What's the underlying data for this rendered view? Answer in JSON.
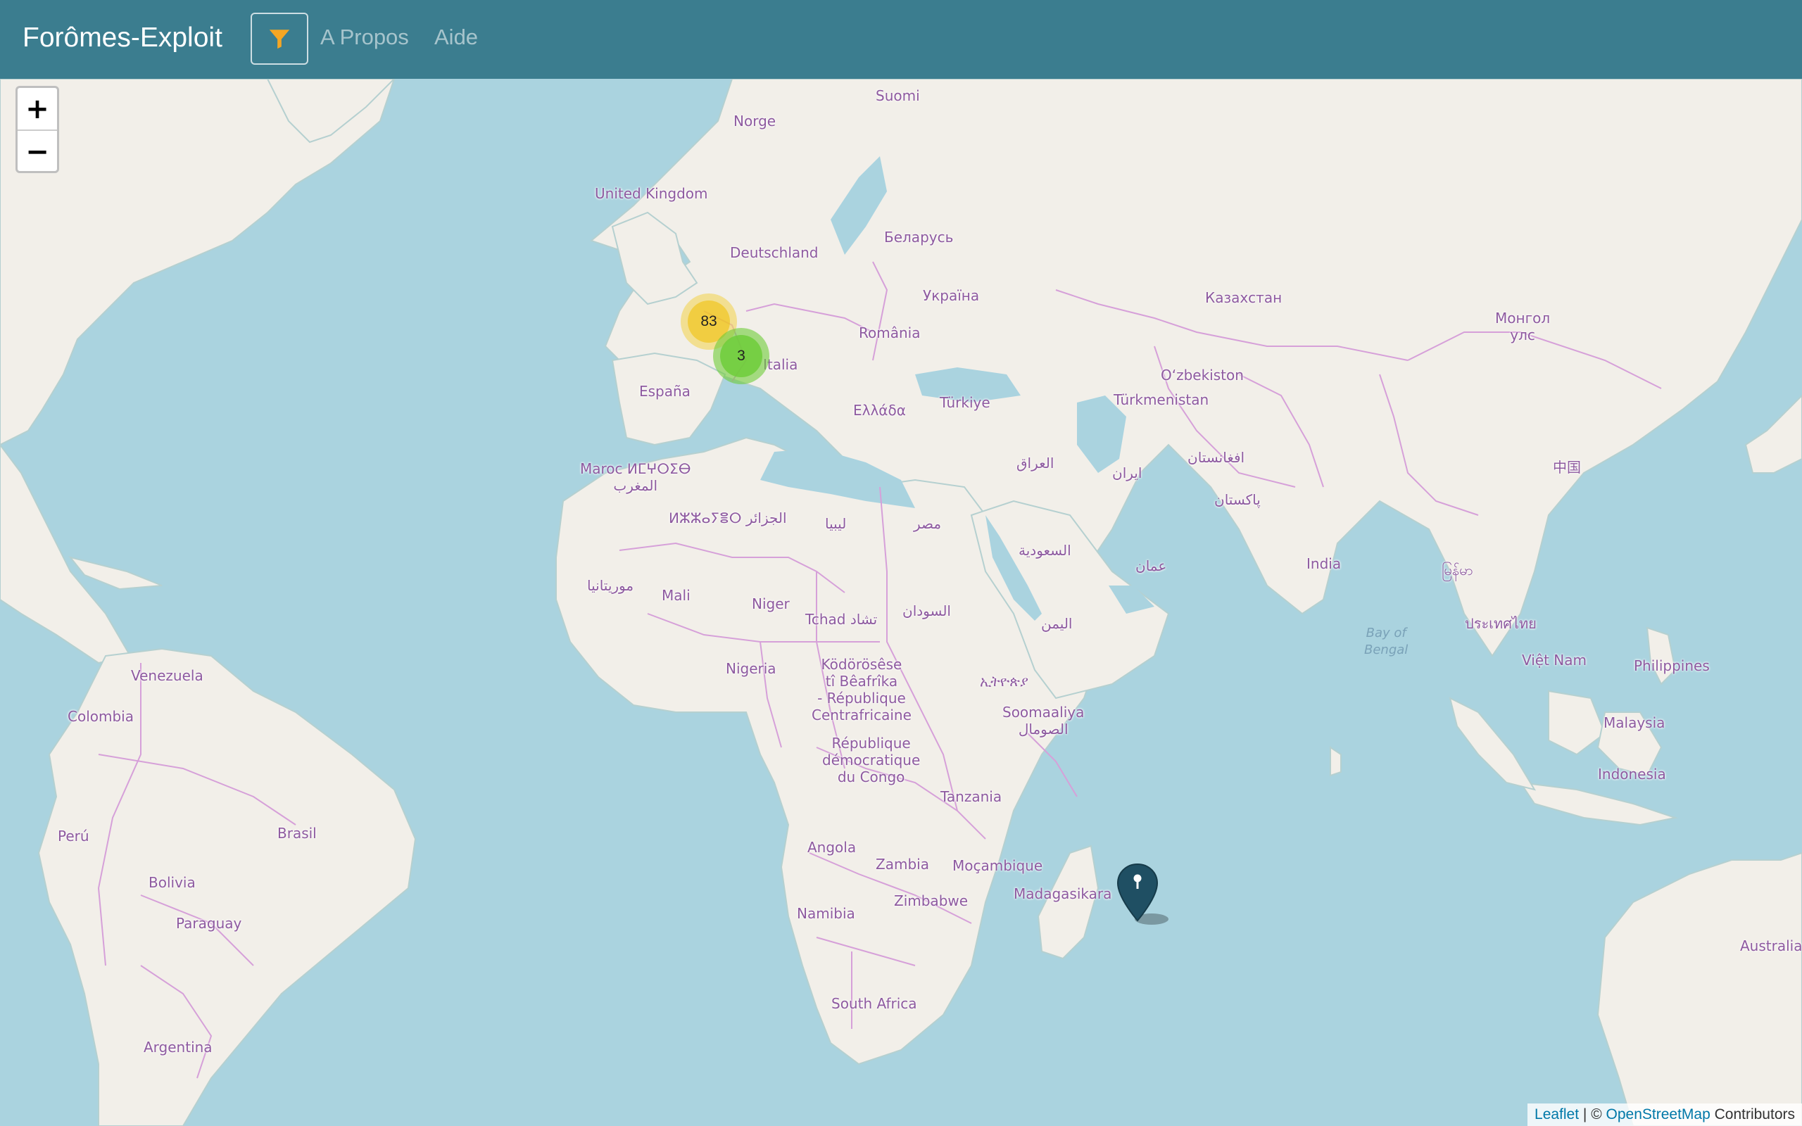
{
  "navbar": {
    "brand": "Forômes-Exploit",
    "filter_icon": "filter-icon",
    "links": [
      "A Propos",
      "Aide"
    ]
  },
  "zoom": {
    "in": "+",
    "out": "−"
  },
  "clusters": [
    {
      "count": "83",
      "color": "#f1d357"
    },
    {
      "count": "3",
      "color": "#6ecc39"
    }
  ],
  "marker": {
    "icon": "map-pin-icon",
    "color": "#1f4f63"
  },
  "labels": {
    "suomi": "Suomi",
    "norge": "Norge",
    "uk": "United Kingdom",
    "deutschland": "Deutschland",
    "belarus": "Беларусь",
    "ukraine": "Україна",
    "romania": "România",
    "italia": "Italia",
    "espana": "España",
    "greece": "Ελλάδα",
    "turkiye": "Türkiye",
    "kazakhstan": "Казахстан",
    "mongolia": "Монгол\nулс",
    "uzbekistan": "O‘zbekiston",
    "turkmenistan": "Türkmenistan",
    "china": "中国",
    "iraq": "العراق",
    "iran": "ایران",
    "afghanistan": "افغانستان",
    "pakistan": "پاکستان",
    "saudi": "السعودية",
    "oman": "عمان",
    "yemen": "اليمن",
    "india": "India",
    "myanmar": "မြန်မာ",
    "thailand": "ประเทศไทย",
    "vietnam": "Việt Nam",
    "philippines": "Philippines",
    "malaysia": "Malaysia",
    "indonesia": "Indonesia",
    "australia": "Australia",
    "bay_of_bengal": "Bay of\nBengal",
    "maroc": "Maroc ⵍⵎⵖⵔⵉⴱ\nالمغرب",
    "algeria": "ⵍⵣⵣⴰⵢⴻⵔ الجزائر",
    "libya": "ليبيا",
    "egypt": "مصر",
    "mauritania": "موريتانيا",
    "mali": "Mali",
    "niger": "Niger",
    "chad": "Tchad تشاد",
    "sudan": "السودان",
    "nigeria": "Nigeria",
    "car": "Ködörösêse\ntî Bêafrîka\n- République\nCentrafricaine",
    "ethiopia": "ኢትዮጵያ",
    "somalia": "Soomaaliya\nالصومال",
    "drc": "République\ndémocratique\ndu Congo",
    "tanzania": "Tanzania",
    "angola": "Angola",
    "zambia": "Zambia",
    "mozambique": "Moçambique",
    "madagascar": "Madagasikara",
    "zimbabwe": "Zimbabwe",
    "namibia": "Namibia",
    "south_africa": "South Africa",
    "venezuela": "Venezuela",
    "colombia": "Colombia",
    "peru": "Perú",
    "brasil": "Brasil",
    "bolivia": "Bolivia",
    "paraguay": "Paraguay",
    "argentina": "Argentina"
  },
  "attribution": {
    "leaflet": "Leaflet",
    "sep": " | © ",
    "osm": "OpenStreetMap",
    "contrib": " Contributors"
  }
}
